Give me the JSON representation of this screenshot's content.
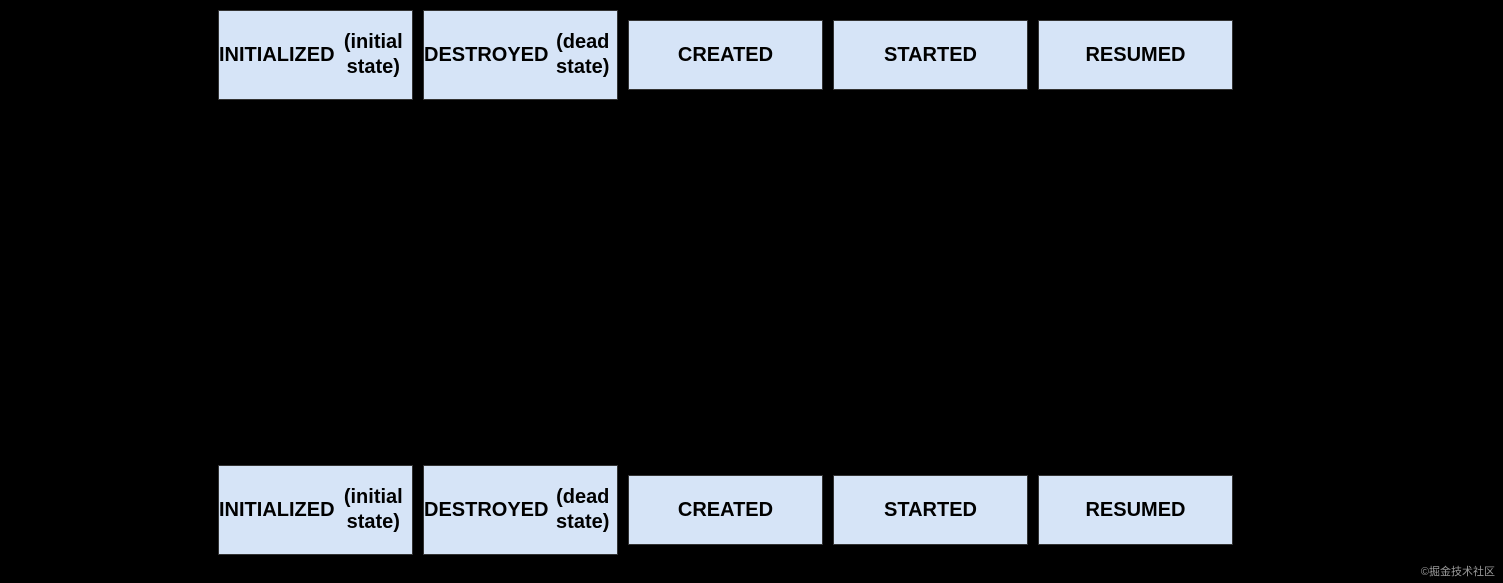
{
  "diagram": {
    "background": "#000000",
    "rows": [
      {
        "id": "top",
        "boxes": [
          {
            "id": "initialized-top",
            "line1": "INITIALIZED",
            "line2": "(initial state)"
          },
          {
            "id": "destroyed-top",
            "line1": "DESTROYED",
            "line2": "(dead state)"
          },
          {
            "id": "created-top",
            "line1": "CREATED",
            "line2": null
          },
          {
            "id": "started-top",
            "line1": "STARTED",
            "line2": null
          },
          {
            "id": "resumed-top",
            "line1": "RESUMED",
            "line2": null
          }
        ]
      },
      {
        "id": "bottom",
        "boxes": [
          {
            "id": "initialized-bottom",
            "line1": "INITIALIZED",
            "line2": "(initial state)"
          },
          {
            "id": "destroyed-bottom",
            "line1": "DESTROYED",
            "line2": "(dead state)"
          },
          {
            "id": "created-bottom",
            "line1": "CREATED",
            "line2": null
          },
          {
            "id": "started-bottom",
            "line1": "STARTED",
            "line2": null
          },
          {
            "id": "resumed-bottom",
            "line1": "RESUMED",
            "line2": null
          }
        ]
      }
    ],
    "watermark": "©掘金技术社区"
  }
}
